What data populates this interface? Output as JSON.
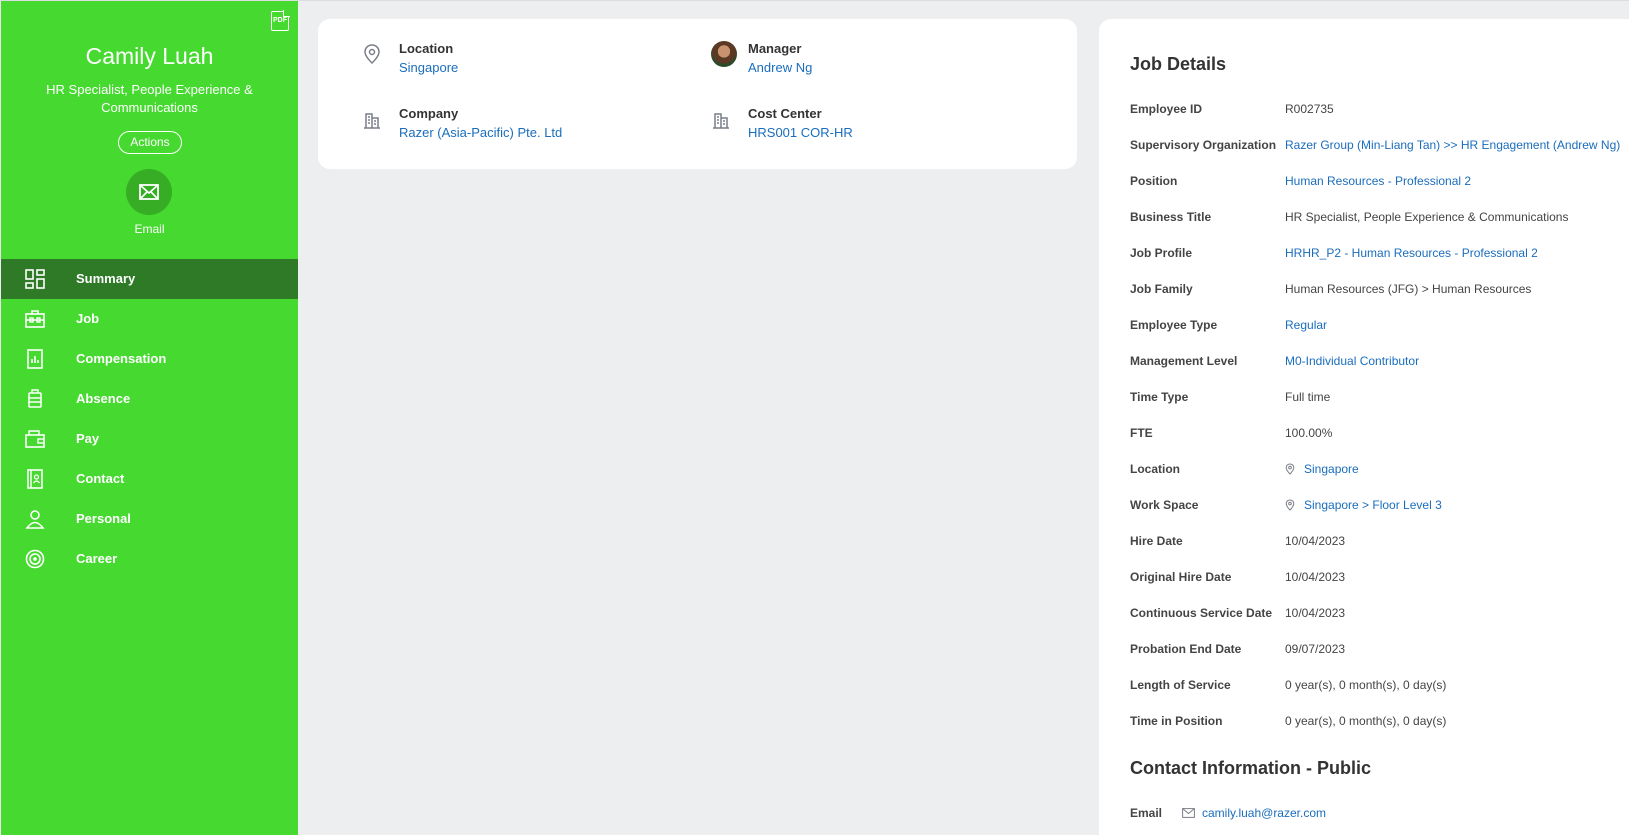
{
  "profile": {
    "name": "Camily Luah",
    "title": "HR Specialist, People Experience & Communications",
    "actions_label": "Actions",
    "email_label": "Email",
    "pdf_label": "PDF"
  },
  "nav": {
    "items": [
      {
        "label": "Summary",
        "icon": "dashboard-icon",
        "active": true
      },
      {
        "label": "Job",
        "icon": "briefcase-icon"
      },
      {
        "label": "Compensation",
        "icon": "compensation-chart-icon"
      },
      {
        "label": "Absence",
        "icon": "luggage-icon"
      },
      {
        "label": "Pay",
        "icon": "wallet-icon"
      },
      {
        "label": "Contact",
        "icon": "contact-book-icon"
      },
      {
        "label": "Personal",
        "icon": "person-icon"
      },
      {
        "label": "Career",
        "icon": "target-icon"
      }
    ]
  },
  "summary": {
    "location": {
      "label": "Location",
      "value": "Singapore"
    },
    "manager": {
      "label": "Manager",
      "value": "Andrew Ng"
    },
    "company": {
      "label": "Company",
      "value": "Razer (Asia-Pacific) Pte. Ltd"
    },
    "cost_center": {
      "label": "Cost Center",
      "value": "HRS001 COR-HR"
    }
  },
  "job_details": {
    "title": "Job Details",
    "rows": [
      {
        "label": "Employee ID",
        "value": "R002735"
      },
      {
        "label": "Supervisory Organization",
        "value": "Razer Group (Min-Liang Tan) >> HR Engagement (Andrew Ng)"
      },
      {
        "label": "Position",
        "value": "Human Resources - Professional 2"
      },
      {
        "label": "Business Title",
        "value": "HR Specialist, People Experience & Communications"
      },
      {
        "label": "Job Profile",
        "value": "HRHR_P2 - Human Resources - Professional 2"
      },
      {
        "label": "Job Family",
        "value": "Human Resources (JFG) > Human Resources"
      },
      {
        "label": "Employee Type",
        "value": "Regular"
      },
      {
        "label": "Management Level",
        "value": "M0-Individual Contributor"
      },
      {
        "label": "Time Type",
        "value": "Full time"
      },
      {
        "label": "FTE",
        "value": "100.00%"
      },
      {
        "label": "Location",
        "value": "Singapore"
      },
      {
        "label": "Work Space",
        "value": "Singapore > Floor Level 3"
      },
      {
        "label": "Hire Date",
        "value": "10/04/2023"
      },
      {
        "label": "Original Hire Date",
        "value": "10/04/2023"
      },
      {
        "label": "Continuous Service Date",
        "value": "10/04/2023"
      },
      {
        "label": "Probation End Date",
        "value": "09/07/2023"
      },
      {
        "label": "Length of Service",
        "value": "0 year(s), 0 month(s), 0 day(s)"
      },
      {
        "label": "Time in Position",
        "value": "0 year(s), 0 month(s), 0 day(s)"
      }
    ]
  },
  "contact_public": {
    "title": "Contact Information - Public",
    "email_label": "Email",
    "email_value": "camily.luah@razer.com"
  },
  "colors": {
    "sidebar": "#46d92f",
    "active_nav": "#2e7a26",
    "link": "#1a6dbd",
    "background": "#edeef0"
  }
}
